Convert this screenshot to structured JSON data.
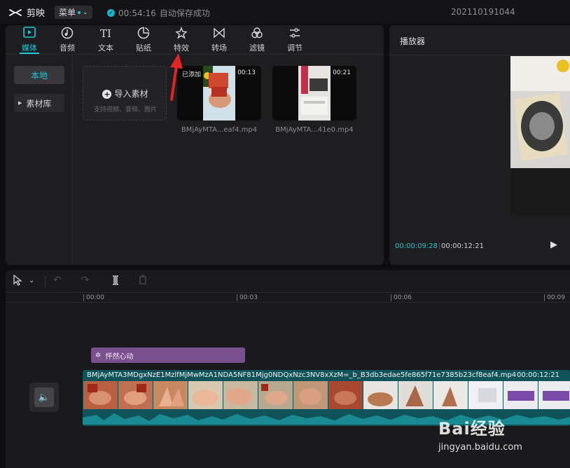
{
  "app": {
    "name": "剪映",
    "menu_label": "菜单",
    "save_time": "00:54:16",
    "save_text": "自动保存成功",
    "project_name": "202110191044"
  },
  "toolbar": {
    "items": [
      {
        "label": "媒体",
        "icon": "media-icon",
        "active": true
      },
      {
        "label": "音频",
        "icon": "audio-icon"
      },
      {
        "label": "文本",
        "icon": "text-icon"
      },
      {
        "label": "贴纸",
        "icon": "sticker-icon"
      },
      {
        "label": "特效",
        "icon": "effects-icon"
      },
      {
        "label": "转场",
        "icon": "transition-icon"
      },
      {
        "label": "滤镜",
        "icon": "filter-icon"
      },
      {
        "label": "调节",
        "icon": "adjust-icon"
      }
    ],
    "text_icon_glyph": "TI"
  },
  "sidebar": {
    "local_label": "本地",
    "library_label": "素材库"
  },
  "import": {
    "title": "导入素材",
    "subtitle": "支持视频、音频、图片"
  },
  "clips": [
    {
      "name": "BMjAyMTA...eaf4.mp4",
      "duration": "00:13",
      "added_tag": "已添加"
    },
    {
      "name": "BMjAyMTA...41e0.mp4",
      "duration": "00:21"
    }
  ],
  "player": {
    "title": "播放器",
    "current_time": "00:00:09:28",
    "total_time": "00:00:12:21"
  },
  "timeline": {
    "ruler": [
      "00:00",
      "00:03",
      "00:06",
      "00:09"
    ],
    "effect_clip": "怦然心动",
    "video_track_name": "BMjAyMTA3MDgxNzE1MzlfMjMwMzA1NDA5NF81Mjg0NDQxNzc3NV8xXzM=_b_B3db3edae5fe865f71e7385b23cf8eaf4.mp4",
    "video_track_duration": "00:00:12:21"
  },
  "watermark": {
    "brand": "Bai经验",
    "url": "jingyan.baidu.com"
  },
  "colors": {
    "accent": "#1fc7d8",
    "effect_clip": "#7a4f8f",
    "video_track": "#0f5258",
    "arrow": "#e02525"
  }
}
